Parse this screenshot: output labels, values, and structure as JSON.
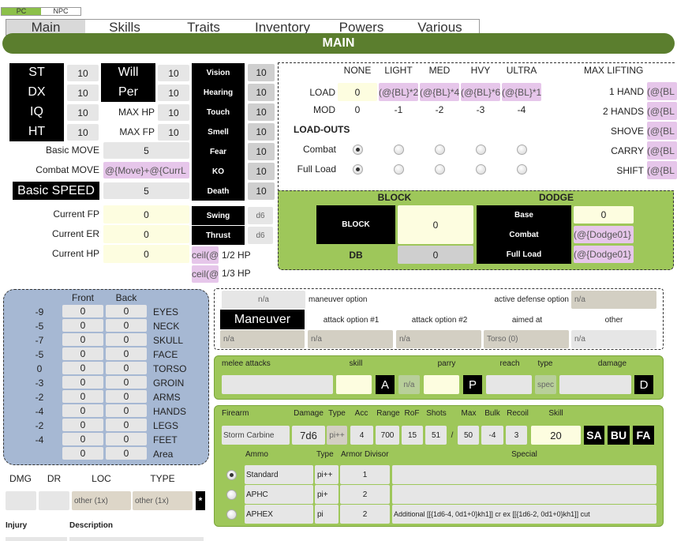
{
  "mode_toggle": {
    "pc": "PC",
    "npc": "NPC"
  },
  "tabs": [
    "Main",
    "Skills",
    "Traits",
    "Inventory",
    "Powers",
    "Various"
  ],
  "section_title": "MAIN",
  "attributes": [
    {
      "label": "ST",
      "value": "10"
    },
    {
      "label": "DX",
      "value": "10"
    },
    {
      "label": "IQ",
      "value": "10"
    },
    {
      "label": "HT",
      "value": "10"
    }
  ],
  "secondary": [
    {
      "label": "Will",
      "value": "10"
    },
    {
      "label": "Per",
      "value": "10"
    },
    {
      "label": "MAX HP",
      "value": "10"
    },
    {
      "label": "MAX FP",
      "value": "10"
    }
  ],
  "senses": [
    {
      "label": "Vision",
      "value": "10"
    },
    {
      "label": "Hearing",
      "value": "10"
    },
    {
      "label": "Touch",
      "value": "10"
    },
    {
      "label": "Smell",
      "value": "10"
    },
    {
      "label": "Fear",
      "value": "10"
    },
    {
      "label": "KO",
      "value": "10"
    },
    {
      "label": "Death",
      "value": "10"
    }
  ],
  "move": {
    "basic_label": "Basic MOVE",
    "basic_value": "5",
    "combat_label": "Combat MOVE",
    "combat_value": "@{Move}+@{CurrL",
    "speed_label": "Basic SPEED",
    "speed_value": "5"
  },
  "current": {
    "fp_label": "Current FP",
    "fp_value": "0",
    "er_label": "Current ER",
    "er_value": "0",
    "hp_label": "Current HP",
    "hp_value": "0"
  },
  "damage": {
    "swing_label": "Swing",
    "swing_value": "d6",
    "thrust_label": "Thrust",
    "thrust_value": "d6"
  },
  "hp_fractions": [
    {
      "formula": "ceil(@",
      "label": "1/2 HP"
    },
    {
      "formula": "ceil(@",
      "label": "1/3 HP"
    }
  ],
  "load": {
    "headers": [
      "NONE",
      "LIGHT",
      "MED",
      "HVY",
      "ULTRA"
    ],
    "load_label": "LOAD",
    "load_values": [
      "0",
      "(@{BL}*2",
      "(@{BL}*4",
      "(@{BL}*6",
      "(@{BL}*1"
    ],
    "mod_label": "MOD",
    "mod_values": [
      "0",
      "-1",
      "-2",
      "-3",
      "-4"
    ],
    "loadouts_label": "LOAD-OUTS",
    "combat_label": "Combat",
    "full_label": "Full Load",
    "combat_selected": 0,
    "full_selected": 0
  },
  "lifting": {
    "title": "MAX LIFTING",
    "rows": [
      {
        "label": "1 HAND",
        "value": "(@{BL"
      },
      {
        "label": "2 HANDS",
        "value": "(@{BL"
      },
      {
        "label": "SHOVE",
        "value": "(@{BL"
      },
      {
        "label": "CARRY",
        "value": "(@{BL"
      },
      {
        "label": "SHIFT",
        "value": "(@{BL"
      }
    ]
  },
  "defense": {
    "block_header": "BLOCK",
    "dodge_header": "DODGE",
    "block_label": "BLOCK",
    "block_value": "0",
    "db_label": "DB",
    "db_value": "0",
    "dodge_rows": [
      {
        "label": "Base",
        "value": "0"
      },
      {
        "label": "Combat",
        "value": "(@{Dodge01}"
      },
      {
        "label": "Full Load",
        "value": "(@{Dodge01}"
      }
    ]
  },
  "hit_locations": {
    "front_header": "Front",
    "back_header": "Back",
    "rows": [
      {
        "mod": "-9",
        "front": "0",
        "back": "0",
        "name": "EYES"
      },
      {
        "mod": "-5",
        "front": "0",
        "back": "0",
        "name": "NECK"
      },
      {
        "mod": "-7",
        "front": "0",
        "back": "0",
        "name": "SKULL"
      },
      {
        "mod": "-5",
        "front": "0",
        "back": "0",
        "name": "FACE"
      },
      {
        "mod": "0",
        "front": "0",
        "back": "0",
        "name": "TORSO"
      },
      {
        "mod": "-3",
        "front": "0",
        "back": "0",
        "name": "GROIN"
      },
      {
        "mod": "-2",
        "front": "0",
        "back": "0",
        "name": "ARMS"
      },
      {
        "mod": "-4",
        "front": "0",
        "back": "0",
        "name": "HANDS"
      },
      {
        "mod": "-2",
        "front": "0",
        "back": "0",
        "name": "LEGS"
      },
      {
        "mod": "-4",
        "front": "0",
        "back": "0",
        "name": "FEET"
      },
      {
        "mod": "",
        "front": "0",
        "back": "0",
        "name": "Area"
      }
    ]
  },
  "injury_table": {
    "headers": [
      "DMG",
      "DR",
      "LOC",
      "TYPE"
    ],
    "loc_value": "other (1x)",
    "type_value": "other (1x)",
    "star": "*",
    "injury_label": "Injury",
    "description_label": "Description"
  },
  "maneuver": {
    "option_value": "n/a",
    "option_label": "maneuver option",
    "active_label": "active defense option",
    "active_value": "n/a",
    "title": "Maneuver",
    "attack1_label": "attack option #1",
    "attack2_label": "attack option #2",
    "aimed_label": "aimed at",
    "other_label": "other",
    "values": [
      "n/a",
      "n/a",
      "n/a",
      "Torso (0)",
      "n/a"
    ]
  },
  "melee": {
    "headers": [
      "melee attacks",
      "skill",
      "parry",
      "reach",
      "type",
      "damage"
    ],
    "a_button": "A",
    "na": "n/a",
    "p_button": "P",
    "spec": "spec",
    "d_button": "D"
  },
  "firearm": {
    "headers": [
      "Firearm",
      "Damage",
      "Type",
      "Acc",
      "Range",
      "RoF",
      "Shots",
      "/",
      "Max",
      "Bulk",
      "Recoil",
      "Skill"
    ],
    "name": "Storm Carbine",
    "damage": "7d6",
    "type": "pi++",
    "acc": "4",
    "range": "700",
    "rof": "15",
    "shots": "51",
    "slash": "/",
    "max": "50",
    "bulk": "-4",
    "recoil": "3",
    "skill": "20",
    "buttons": [
      "SA",
      "BU",
      "FA"
    ],
    "ammo_headers": [
      "Ammo",
      "Type",
      "Armor Divisor",
      "Special"
    ],
    "ammo": [
      {
        "name": "Standard",
        "type": "pi++",
        "divisor": "1",
        "special": "",
        "selected": true
      },
      {
        "name": "APHC",
        "type": "pi+",
        "divisor": "2",
        "special": "",
        "selected": false
      },
      {
        "name": "APHEX",
        "type": "pi",
        "divisor": "2",
        "special": "Additional [[{1d6-4, 0d1+0}kh1]] cr ex [[{1d6-2, 0d1+0}kh1]] cut",
        "selected": false
      }
    ]
  }
}
